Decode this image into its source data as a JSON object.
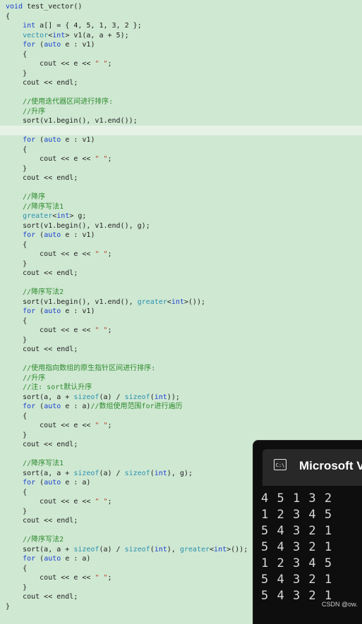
{
  "code": {
    "lines": [
      "void test_vector()",
      "{",
      "    int a[] = { 4, 5, 1, 3, 2 };",
      "    vector<int> v1(a, a + 5);",
      "    for (auto e : v1)",
      "    {",
      "        cout << e << \" \";",
      "    }",
      "    cout << endl;",
      "",
      "    //使用迭代器区间进行排序:",
      "    //升序",
      "    sort(v1.begin(), v1.end());",
      "",
      "    for (auto e : v1)",
      "    {",
      "        cout << e << \" \";",
      "    }",
      "    cout << endl;",
      "",
      "    //降序",
      "    //降序写法1",
      "    greater<int> g;",
      "    sort(v1.begin(), v1.end(), g);",
      "    for (auto e : v1)",
      "    {",
      "        cout << e << \" \";",
      "    }",
      "    cout << endl;",
      "",
      "    //降序写法2",
      "    sort(v1.begin(), v1.end(), greater<int>());",
      "    for (auto e : v1)",
      "    {",
      "        cout << e << \" \";",
      "    }",
      "    cout << endl;",
      "",
      "    //使用指向数组的原生指针区间进行排序:",
      "    //升序",
      "    //注: sort默认升序",
      "    sort(a, a + sizeof(a) / sizeof(int));",
      "    for (auto e : a)//数组使用范围for进行遍历",
      "    {",
      "        cout << e << \" \";",
      "    }",
      "    cout << endl;",
      "",
      "    //降序写法1",
      "    sort(a, a + sizeof(a) / sizeof(int), g);",
      "    for (auto e : a)",
      "    {",
      "        cout << e << \" \";",
      "    }",
      "    cout << endl;",
      "",
      "    //降序写法2",
      "    sort(a, a + sizeof(a) / sizeof(int), greater<int>());",
      "    for (auto e : a)",
      "    {",
      "        cout << e << \" \";",
      "    }",
      "    cout << endl;",
      "}"
    ]
  },
  "console": {
    "title": "Microsoft V",
    "icon_label": "C:\\",
    "icon": "terminal-icon",
    "output": [
      "4 5 1 3 2",
      "1 2 3 4 5",
      "5 4 3 2 1",
      "5 4 3 2 1",
      "1 2 3 4 5",
      "5 4 3 2 1",
      "5 4 3 2 1"
    ]
  },
  "watermark": "CSDN @ow.",
  "colors": {
    "editor_bg": "#cfe8d2",
    "keyword": "#1a3fd1",
    "type": "#2b91af",
    "comment": "#2e8b2e",
    "string": "#b1402b",
    "console_bg": "#0e0e0e"
  }
}
